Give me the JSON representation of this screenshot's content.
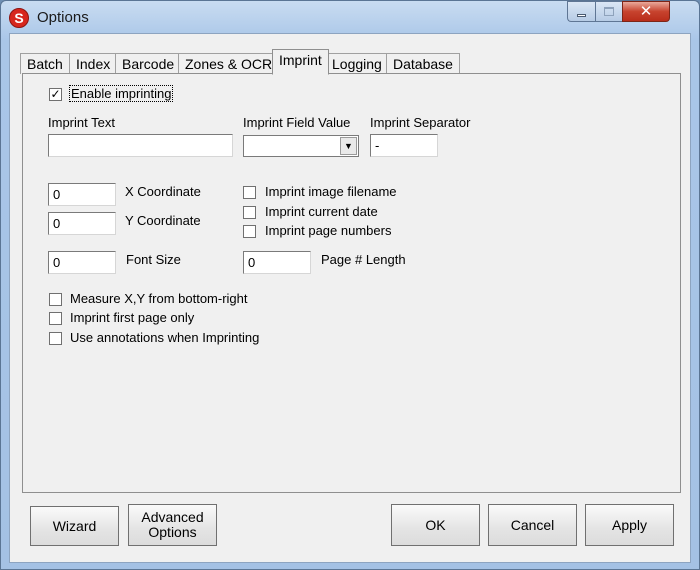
{
  "window": {
    "title": "Options",
    "app_icon_letter": "S",
    "controls": {
      "minimize": "minimize-icon",
      "maximize": "maximize-icon",
      "close": "close-icon"
    }
  },
  "tabs": [
    {
      "label": "Batch",
      "active": false
    },
    {
      "label": "Index",
      "active": false
    },
    {
      "label": "Barcode",
      "active": false
    },
    {
      "label": "Zones & OCR",
      "active": false
    },
    {
      "label": "Imprint",
      "active": true
    },
    {
      "label": "Logging",
      "active": false
    },
    {
      "label": "Database",
      "active": false
    }
  ],
  "imprint": {
    "enable_label": "Enable imprinting",
    "enable_checked": true,
    "text_label": "Imprint Text",
    "text_value": "",
    "field_value_label": "Imprint Field Value",
    "field_value_selected": "",
    "separator_label": "Imprint Separator",
    "separator_value": "-",
    "x_coord_label": "X Coordinate",
    "x_coord_value": "0",
    "y_coord_label": "Y Coordinate",
    "y_coord_value": "0",
    "font_size_label": "Font Size",
    "font_size_value": "0",
    "page_len_label": "Page # Length",
    "page_len_value": "0",
    "options_right": [
      {
        "label": "Imprint image filename",
        "checked": false
      },
      {
        "label": "Imprint current date",
        "checked": false
      },
      {
        "label": "Imprint page numbers",
        "checked": false
      }
    ],
    "options_bottom": [
      {
        "label": "Measure X,Y from bottom-right",
        "checked": false
      },
      {
        "label": "Imprint first page only",
        "checked": false
      },
      {
        "label": "Use annotations when Imprinting",
        "checked": false
      }
    ]
  },
  "buttons": {
    "wizard": "Wizard",
    "advanced": "Advanced\nOptions",
    "ok": "OK",
    "cancel": "Cancel",
    "apply": "Apply"
  }
}
